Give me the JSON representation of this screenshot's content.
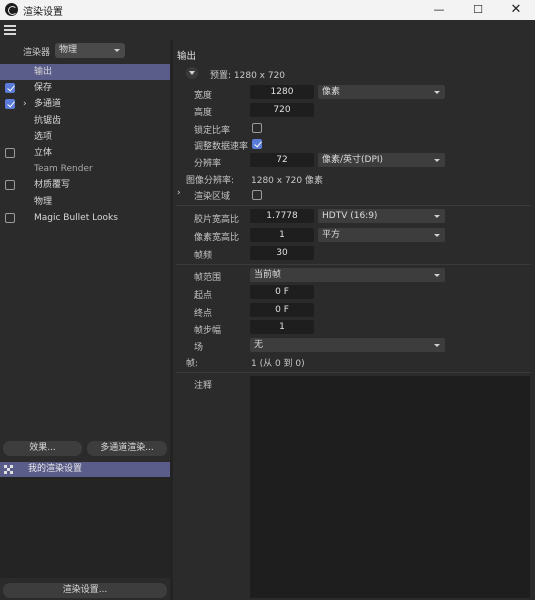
{
  "window": {
    "title": "渲染设置",
    "min_glyph": "—",
    "max_glyph": "☐",
    "close_glyph": "✕"
  },
  "left": {
    "renderer_label": "渲染器",
    "renderer_value": "物理",
    "tree": [
      {
        "label": "输出",
        "checkbox": null,
        "selected": true,
        "expander": false,
        "dim": false
      },
      {
        "label": "保存",
        "checkbox": true,
        "selected": false,
        "expander": false,
        "dim": false
      },
      {
        "label": "多通道",
        "checkbox": true,
        "selected": false,
        "expander": true,
        "dim": false
      },
      {
        "label": "抗锯齿",
        "checkbox": null,
        "selected": false,
        "expander": false,
        "dim": false
      },
      {
        "label": "选项",
        "checkbox": null,
        "selected": false,
        "expander": false,
        "dim": false
      },
      {
        "label": "立体",
        "checkbox": false,
        "selected": false,
        "expander": false,
        "dim": false
      },
      {
        "label": "Team Render",
        "checkbox": null,
        "selected": false,
        "expander": false,
        "dim": true
      },
      {
        "label": "材质覆写",
        "checkbox": false,
        "selected": false,
        "expander": false,
        "dim": false
      },
      {
        "label": "物理",
        "checkbox": null,
        "selected": false,
        "expander": false,
        "dim": false
      },
      {
        "label": "Magic Bullet Looks",
        "checkbox": false,
        "selected": false,
        "expander": false,
        "dim": false
      }
    ],
    "effects_button": "效果...",
    "multipass_button": "多通道渲染...",
    "preset_label": "我的渲染设置",
    "render_settings_button": "渲染设置..."
  },
  "output": {
    "section_title": "输出",
    "preset_text": "预置: 1280 x 720",
    "width_label": "宽度",
    "width_value": "1280",
    "width_unit": "像素",
    "height_label": "高度",
    "height_value": "720",
    "lock_ratio_label": "锁定比率",
    "lock_ratio_checked": false,
    "adjust_rate_label": "调整数据速率",
    "adjust_rate_checked": true,
    "resolution_label": "分辨率",
    "resolution_value": "72",
    "resolution_unit": "像素/英寸(DPI)",
    "image_res_label": "图像分辨率:",
    "image_res_value": "1280 x 720 像素",
    "render_region_label": "渲染区域",
    "render_region_checked": false,
    "film_aspect_label": "胶片宽高比",
    "film_aspect_value": "1.7778",
    "film_aspect_preset": "HDTV (16:9)",
    "pixel_aspect_label": "像素宽高比",
    "pixel_aspect_value": "1",
    "pixel_aspect_preset": "平方",
    "fps_label": "帧频",
    "fps_value": "30",
    "frame_range_label": "帧范围",
    "frame_range_value": "当前帧",
    "start_label": "起点",
    "start_value": "0 F",
    "end_label": "终点",
    "end_value": "0 F",
    "frame_step_label": "帧步幅",
    "frame_step_value": "1",
    "field_label": "场",
    "field_value": "无",
    "frames_label": "帧:",
    "frames_value": "1 (从 0 到 0)",
    "notes_label": "注释",
    "expander_glyph": "›"
  }
}
